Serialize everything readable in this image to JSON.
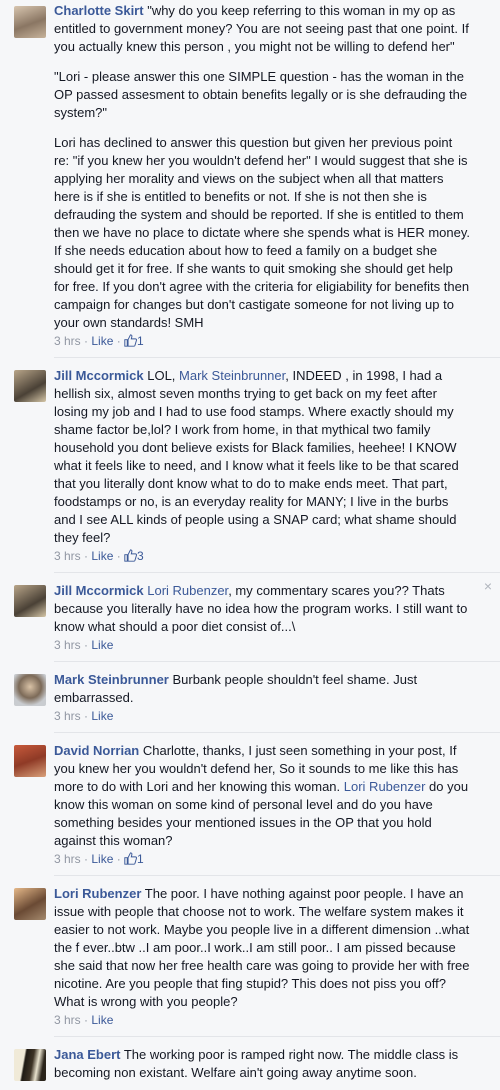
{
  "comments": [
    {
      "author": "Charlotte Skirt",
      "paragraphs": [
        "\"why do you keep referring to this woman in my op as entitled to government money? You are not seeing past that one point. If you actually knew this person , you might not be willing to defend her\"",
        "\"Lori - please answer this one SIMPLE question - has the woman in the OP passed assesment to obtain benefits legally or is she defrauding the system?\"",
        "Lori has declined to answer this question but given her previous point re: \"if you knew her you wouldn't defend her\" I would suggest that she is applying her morality and views on the subject when all that matters here is if she is entitled to benefits or not. If she is not then she is defrauding the system and should be reported. If she is entitled to them then we have no place to dictate where she spends what is HER money. If she needs education about how to feed a family on a budget she should get it for free. If she wants to quit smoking she should get help for free. If you don't agree with the criteria for eligiability for benefits then campaign for changes but don't castigate someone for not living up to your own standards! SMH"
      ],
      "time": "3 hrs",
      "like_label": "Like",
      "like_count": "1"
    },
    {
      "author": "Jill Mccormick",
      "pre": " LOL, ",
      "mention": "Mark Steinbrunner",
      "post": ", INDEED , in 1998, I had a hellish six, almost seven months trying to get back on my feet after losing my job and I had to use food stamps. Where exactly should my shame factor be,lol? I work from home, in that mythical two family household you dont believe exists for Black families, heehee! I KNOW what it feels like to need, and I know what it feels like to be that scared that you literally dont know what to do to make ends meet. That part, foodstamps or no, is an everyday reality for MANY; I live in the burbs and I see ALL kinds of people using a SNAP card; what shame should they feel?",
      "time": "3 hrs",
      "like_label": "Like",
      "like_count": "3"
    },
    {
      "author": "Jill Mccormick",
      "mention": "Lori Rubenzer",
      "post": ", my commentary scares you?? Thats because you literally have no idea how the program works. I still want to know what should a poor diet consist of...\\",
      "time": "3 hrs",
      "like_label": "Like",
      "close": "×"
    },
    {
      "author": "Mark Steinbrunner",
      "post": " Burbank people shouldn't feel shame. Just embarrassed.",
      "time": "3 hrs",
      "like_label": "Like"
    },
    {
      "author": "David Norrian",
      "pre": " Charlotte, thanks, I just seen something in your post, If you knew her you wouldn't defend her, So it sounds to me like this has more to do with Lori and her knowing this woman. ",
      "mention": "Lori Rubenzer",
      "post": " do you know this woman on some kind of personal level and do you have something besides your mentioned issues in the OP that you hold against this woman?",
      "time": "3 hrs",
      "like_label": "Like",
      "like_count": "1"
    },
    {
      "author": "Lori Rubenzer",
      "post": " The poor. I have nothing against poor people. I have an issue with people that choose not to work. The welfare system makes it easier to not work. Maybe you people live in a different dimension ..what the f ever..btw ..I am poor..I work..I am still poor.. I am pissed because she said that now her free health care was going to provide her with free nicotine. Are you people that fing stupid? This does not piss you off? What is wrong with you people?",
      "time": "3 hrs",
      "like_label": "Like"
    },
    {
      "author": "Jana Ebert",
      "post": " The working poor is ramped right now. The middle class is becoming non existant. Welfare ain't going away anytime soon."
    }
  ],
  "meta_sep": " · ",
  "colors": {
    "link": "#3b5998",
    "meta": "#9197a3",
    "background": "#f6f7f9"
  },
  "icons": {
    "like": "thumbs-up-icon",
    "close": "close-icon"
  }
}
